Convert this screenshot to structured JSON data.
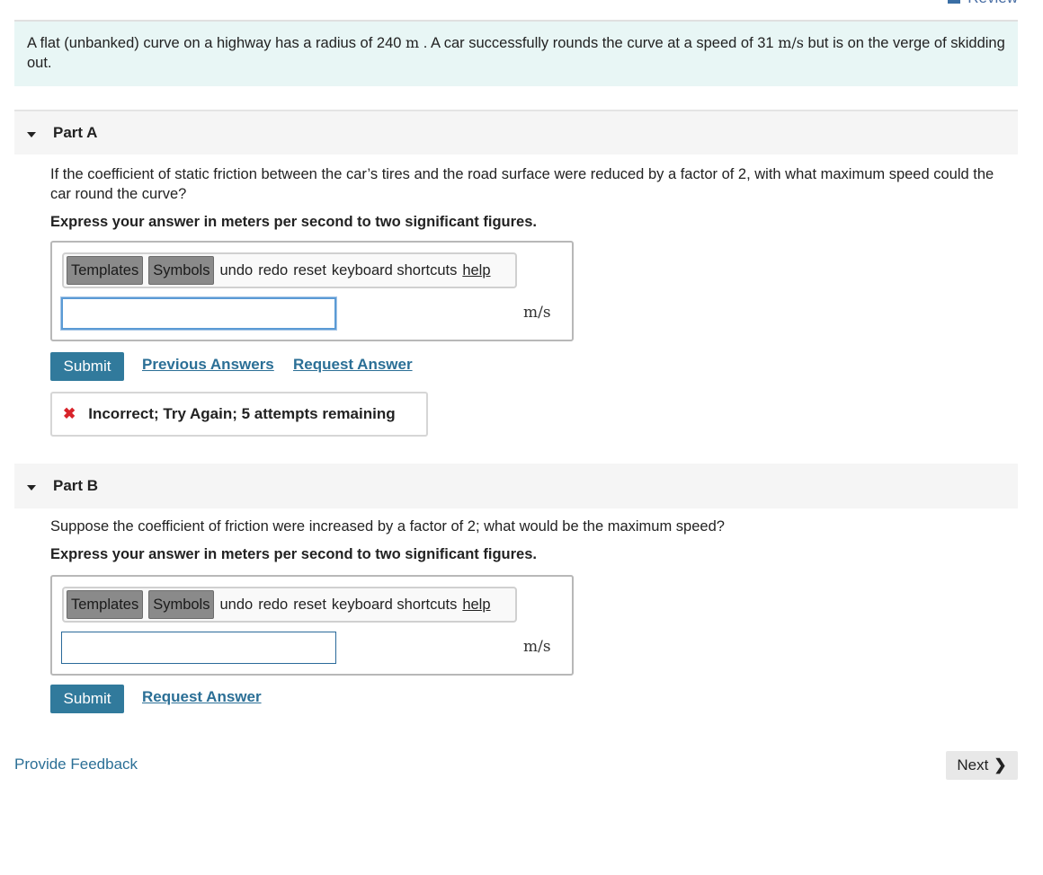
{
  "header": {
    "review_label": "Review"
  },
  "problem": {
    "text_1": "A flat (unbanked) curve on a highway has a radius of 240 ",
    "unit_m": "m",
    "text_2": " . A car successfully rounds the curve at a speed of 31 ",
    "unit_ms": "m/s",
    "text_3": " but is on the verge of skidding out."
  },
  "parts": [
    {
      "title": "Part A",
      "question": "If the coefficient of static friction between the car’s tires and the road surface were reduced by a factor of 2, with what maximum speed could the car round the curve?",
      "instruction": "Express your answer in meters per second to two significant figures.",
      "toolbar": {
        "templates": "Templates",
        "symbols": "Symbols",
        "undo": "undo",
        "redo": "redo",
        "reset": "reset",
        "shortcuts": "keyboard shortcuts",
        "help": "help"
      },
      "input_value": "",
      "unit": "m/s",
      "submit_label": "Submit",
      "previous_answers_label": "Previous Answers",
      "request_answer_label": "Request Answer",
      "feedback": "Incorrect; Try Again; 5 attempts remaining"
    },
    {
      "title": "Part B",
      "question": "Suppose the coefficient of friction were increased by a factor of 2; what would be the maximum speed?",
      "instruction": "Express your answer in meters per second to two significant figures.",
      "toolbar": {
        "templates": "Templates",
        "symbols": "Symbols",
        "undo": "undo",
        "redo": "redo",
        "reset": "reset",
        "shortcuts": "keyboard shortcuts",
        "help": "help"
      },
      "input_value": "",
      "unit": "m/s",
      "submit_label": "Submit",
      "request_answer_label": "Request Answer"
    }
  ],
  "footer": {
    "provide_feedback_label": "Provide Feedback",
    "next_label": "Next"
  },
  "colors": {
    "problem_bg": "#e8f6f5",
    "submit_bg": "#317a9c",
    "link": "#2b6f96",
    "error": "#d8232a"
  },
  "icons": {
    "collapse": "caret-down-icon",
    "error": "x-icon",
    "next": "chevron-right-icon",
    "review": "grid-icon"
  }
}
